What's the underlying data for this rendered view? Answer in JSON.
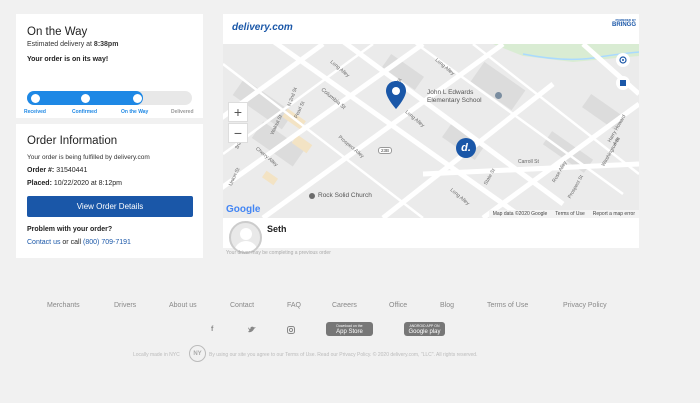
{
  "status": {
    "title": "On the Way",
    "estimate_prefix": "Estimated delivery at ",
    "estimate_time": "8:38pm",
    "message": "Your order is on its way!",
    "progress": 0.7,
    "steps": [
      "Received",
      "Confirmed",
      "On the Way",
      "Delivered"
    ]
  },
  "order": {
    "title": "Order Information",
    "fulfilled_text": "Your order is being fulfilled by delivery.com",
    "order_label": "Order #:",
    "order_number": "31540441",
    "placed_label": "Placed:",
    "placed_value": "10/22/2020 at 8:12pm",
    "button_label": "View Order Details",
    "problem_title": "Problem with your order?",
    "contact_link": "Contact us",
    "or_call": " or call ",
    "phone": "(800) 709-7191"
  },
  "map": {
    "brand": "delivery.com",
    "powered_by": "POWERED BY",
    "partner": "BRINGG",
    "school": "John L Edwards\nElementary School",
    "church": "Rock Solid Church",
    "streets": [
      "Long Alley",
      "Columbia St",
      "N 2nd St",
      "Pearl St",
      "Prospect Alley",
      "Cherry Alley",
      "Union St",
      "Walnut St",
      "Long Alley",
      "Long Alley",
      "State St",
      "Carroll St",
      "Rose Alley",
      "Prospect St",
      "Washington St",
      "Harry Howard Ave",
      "Long Alley",
      "3rd St",
      "Pearl St"
    ],
    "route_badge": "23B",
    "google": "Google",
    "attribution": [
      "Map data ©2020 Google",
      "Terms of Use",
      "Report a map error"
    ],
    "zoom_in": "+",
    "zoom_out": "−"
  },
  "driver": {
    "name": "Seth",
    "note": "Your driver may be completing a previous order"
  },
  "footer": {
    "links": [
      "Merchants",
      "Drivers",
      "About us",
      "Contact",
      "FAQ",
      "Careers",
      "Office",
      "Blog",
      "Terms of Use",
      "Privacy Policy"
    ],
    "social": [
      "f",
      "t",
      "ig"
    ],
    "app_store": "App Store",
    "app_store_top": "Download on the",
    "google_play": "Google play",
    "google_play_top": "ANDROID APP ON",
    "made_in": "Locally made in NYC",
    "ny": "NY",
    "legal": "By using our site you agree to our Terms of Use. Read our Privacy Policy. © 2020 delivery.com, \"LLC\". All rights reserved."
  },
  "colors": {
    "accent": "#1e88e5",
    "button": "#1a57a8",
    "pin": "#1a57a8"
  }
}
